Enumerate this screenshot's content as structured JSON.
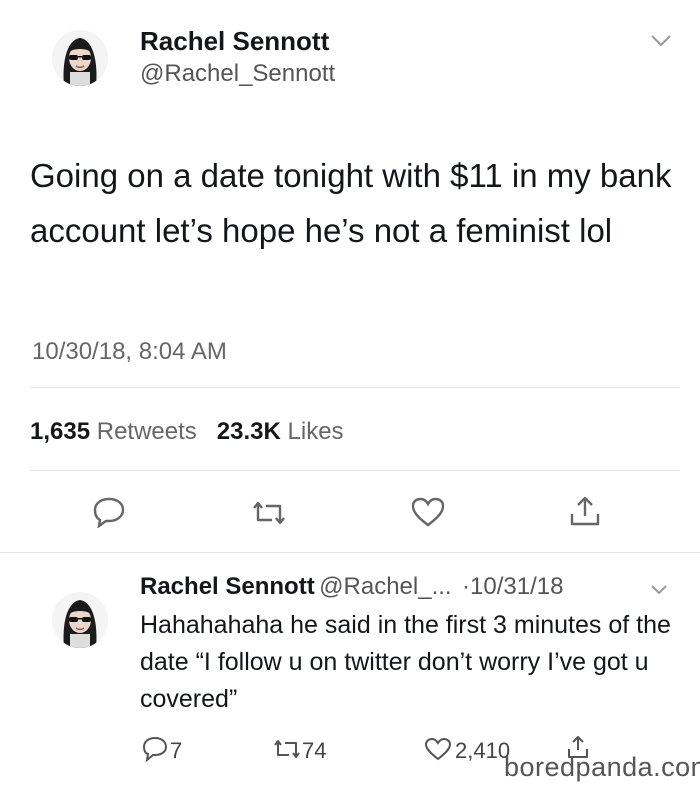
{
  "tweet": {
    "author_name": "Rachel Sennott",
    "author_handle": "@Rachel_Sennott",
    "text": "Going on a date tonight with $11 in my bank account let’s hope he’s not a feminist lol",
    "timestamp": "10/30/18, 8:04 AM",
    "retweets_count": "1,635",
    "retweets_label": "Retweets",
    "likes_count": "23.3K",
    "likes_label": "Likes",
    "icons": [
      "avatar",
      "chevron-down-icon",
      "reply-icon",
      "retweet-icon",
      "like-icon",
      "share-icon"
    ]
  },
  "reply": {
    "author_name": "Rachel Sennott",
    "author_handle": "@Rachel_...",
    "date": "·10/31/18",
    "text": "Hahahahaha he said in the first 3 minutes of the date “I follow u on twitter don’t worry I’ve got u covered”",
    "reply_count": "7",
    "retweet_count": "74",
    "like_count": "2,410"
  },
  "watermark": "boredpanda.com",
  "colors": {
    "text": "#14171a",
    "secondary": "#666666",
    "divider": "#e6e6e6"
  }
}
